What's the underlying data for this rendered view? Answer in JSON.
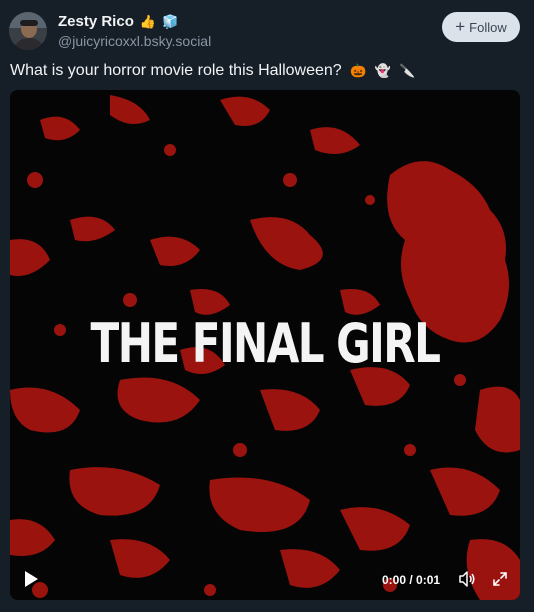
{
  "author": {
    "display_name": "Zesty Rico",
    "name_emojis": [
      "👍",
      "🧊"
    ],
    "handle": "@juicyricoxxl.bsky.social"
  },
  "follow_button": {
    "label": "Follow",
    "icon": "plus-icon"
  },
  "post": {
    "text": "What is your horror movie role this Halloween?",
    "emojis": [
      "🎃",
      "👻",
      "🔪"
    ]
  },
  "video": {
    "title_text": "THE FINAL GIRL",
    "time": "0:00 / 0:01",
    "controls": [
      "play-icon",
      "volume-icon",
      "fullscreen-icon"
    ]
  },
  "colors": {
    "background": "#161e27",
    "blood": "#a8150f",
    "follow_bg": "#dce2ea",
    "handle": "#8a96a5"
  }
}
